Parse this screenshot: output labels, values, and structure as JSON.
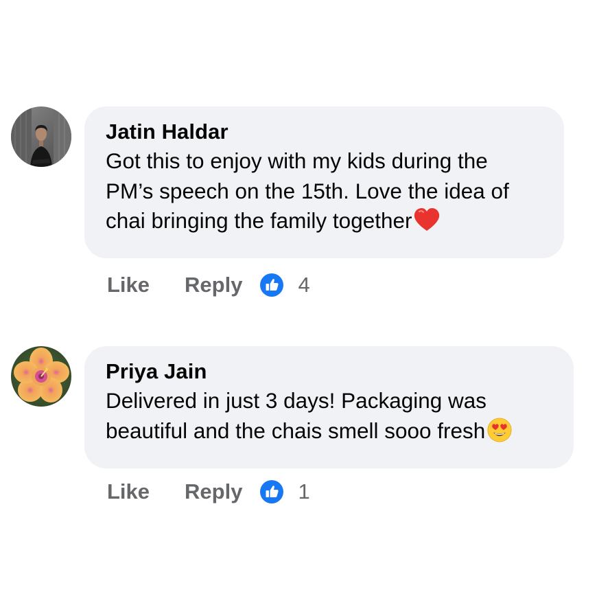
{
  "comments": [
    {
      "author": "Jatin Haldar",
      "text": "Got this to enjoy with my kids during the PM’s speech on the 15th. Love the idea of chai bringing the family together",
      "text_lines": [
        "Got this to enjoy with my kids during the",
        "PM’s speech on the 15th. Love the idea of",
        "chai bringing the family together"
      ],
      "trailing_emoji": "red-heart",
      "avatar": "profile-photo-man-in-black",
      "like_label": "Like",
      "reply_label": "Reply",
      "reaction_icon": "thumbs-up-icon",
      "reaction_count": "4"
    },
    {
      "author": "Priya Jain",
      "text": "Delivered in just 3 days! Packaging was beautiful and the chais smell sooo fresh",
      "text_lines": [
        "Delivered in just 3 days! Packaging was",
        "beautiful and the chais smell sooo fresh"
      ],
      "trailing_emoji": "heart-eyes-face",
      "avatar": "profile-photo-orange-hibiscus",
      "like_label": "Like",
      "reply_label": "Reply",
      "reaction_icon": "thumbs-up-icon",
      "reaction_count": "1"
    }
  ],
  "colors": {
    "bubble_bg": "#f0f2f5",
    "text": "#050505",
    "secondary_text": "#65676b",
    "like_blue": "#1877f2"
  }
}
